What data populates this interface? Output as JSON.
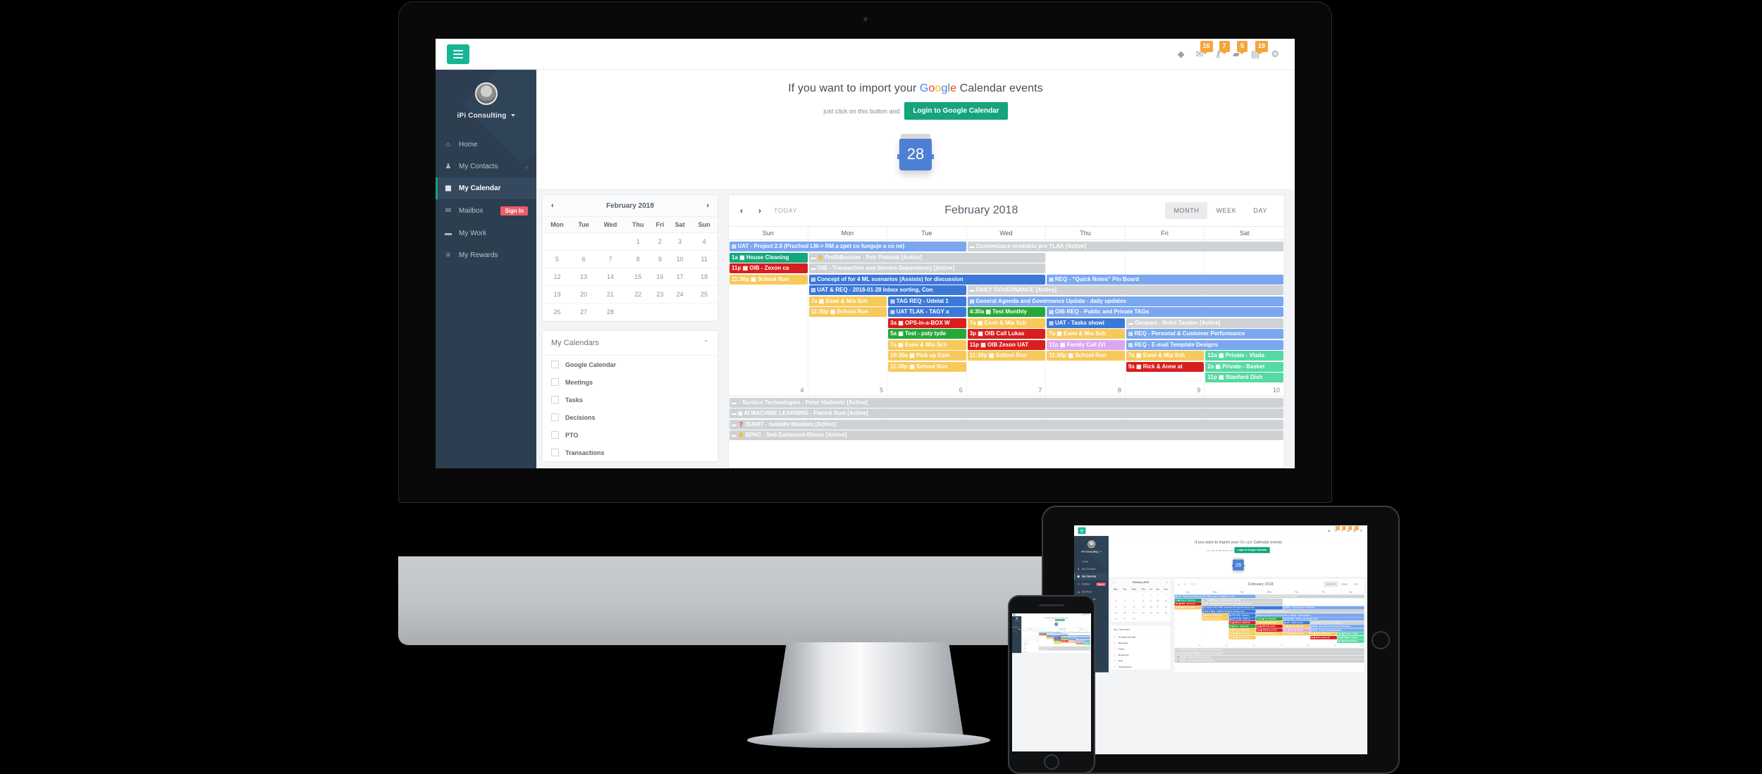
{
  "topbar": {
    "menu_icon": "hamburger-icon",
    "icons": [
      {
        "name": "tag-icon",
        "glyph": "◆",
        "badge": ""
      },
      {
        "name": "mail-icon",
        "glyph": "✉",
        "badge": "16"
      },
      {
        "name": "key-icon",
        "glyph": "⚷",
        "badge": "7"
      },
      {
        "name": "folder-icon",
        "glyph": "▰",
        "badge": "5"
      },
      {
        "name": "card-icon",
        "glyph": "▤",
        "badge": "19"
      },
      {
        "name": "gear-icon",
        "glyph": "⚙",
        "badge": ""
      }
    ]
  },
  "sidebar": {
    "account_name": "iPi Consulting",
    "items": [
      {
        "label": "Home",
        "icon": "⌂",
        "active": false,
        "caret": "",
        "badge": ""
      },
      {
        "label": "My Contacts",
        "icon": "♟",
        "active": false,
        "caret": "‹",
        "badge": ""
      },
      {
        "label": "My Calendar",
        "icon": "▦",
        "active": true,
        "caret": "",
        "badge": ""
      },
      {
        "label": "Mailbox",
        "icon": "✉",
        "active": false,
        "caret": "",
        "badge": "Sign In"
      },
      {
        "label": "My Work",
        "icon": "▬",
        "active": false,
        "caret": "",
        "badge": ""
      },
      {
        "label": "My Rewards",
        "icon": "♕",
        "active": false,
        "caret": "",
        "badge": ""
      }
    ]
  },
  "google_banner": {
    "line1_prefix": "If you want to import your ",
    "brand": {
      "g1": "G",
      "o1": "o",
      "o2": "o",
      "g2": "g",
      "l": "l",
      "e": "e"
    },
    "line1_suffix": " Calendar events",
    "line2": "just click on this button and",
    "button": "Login to Google Calendar",
    "icon_day": "28"
  },
  "mini_calendar": {
    "title": "February 2018",
    "prev": "‹",
    "next": "›",
    "dow": [
      "Mon",
      "Tue",
      "Wed",
      "Thu",
      "Fri",
      "Sat",
      "Sun"
    ],
    "weeks": [
      [
        "",
        "",
        "",
        "1",
        "2",
        "3",
        "4"
      ],
      [
        "5",
        "6",
        "7",
        "8",
        "9",
        "10",
        "11"
      ],
      [
        "12",
        "13",
        "14",
        "15",
        "16",
        "17",
        "18"
      ],
      [
        "19",
        "20",
        "21",
        "22",
        "23",
        "24",
        "25"
      ],
      [
        "26",
        "27",
        "28",
        "",
        "",
        "",
        ""
      ]
    ]
  },
  "my_calendars": {
    "title": "My Calendars",
    "collapse_icon": "⌃",
    "items": [
      "Google Calendar",
      "Meetings",
      "Tasks",
      "Decisions",
      "PTO",
      "Transactions"
    ]
  },
  "big_calendar": {
    "prev": "‹",
    "next": "›",
    "today": "TODAY",
    "title": "February 2018",
    "views": [
      {
        "label": "MONTH",
        "active": true
      },
      {
        "label": "WEEK",
        "active": false
      },
      {
        "label": "DAY",
        "active": false
      }
    ],
    "dow": [
      "Sun",
      "Mon",
      "Tue",
      "Wed",
      "Thu",
      "Fri",
      "Sat"
    ],
    "week1": {
      "daynums": [
        "4",
        "5",
        "6",
        "7",
        "8",
        "9",
        "10"
      ],
      "rows": [
        [
          {
            "col": 1,
            "span": 3,
            "color": "bluelt",
            "icon": "▤",
            "text": "UAT - Project 2.0 (Pruchod LM-> RM a zpet co funguje a co ne)"
          },
          {
            "col": 4,
            "span": 4,
            "color": "gray",
            "icon": "▬",
            "text": "Customizace produktu pro TLAK [Active]"
          }
        ],
        [
          {
            "col": 1,
            "span": 1,
            "color": "green",
            "icon": "",
            "text": "1a ▦ House Cleaning"
          },
          {
            "col": 2,
            "span": 3,
            "color": "gray",
            "icon": "▬ ✋",
            "text": "ProfitBooster - Petr Pistelak [Active]"
          }
        ],
        [
          {
            "col": 1,
            "span": 1,
            "color": "red",
            "icon": "",
            "text": "11p ▦ OIB - Zexon ca"
          },
          {
            "col": 2,
            "span": 3,
            "color": "gray",
            "icon": "▬",
            "text": "OIB - Transaction and Service Dependency [Active]"
          }
        ],
        [
          {
            "col": 1,
            "span": 1,
            "color": "yellow",
            "icon": "",
            "text": "11:30p ▦ School Run"
          },
          {
            "col": 2,
            "span": 3,
            "color": "blue",
            "icon": "▤",
            "text": "Concept of for 4 ML scenarios (Assists) for discussion"
          },
          {
            "col": 5,
            "span": 3,
            "color": "bluelt",
            "icon": "▤",
            "text": "REQ - “Quick Notes” Pin Board"
          }
        ],
        [
          {
            "col": 2,
            "span": 2,
            "color": "blue",
            "icon": "▤",
            "text": "UAT & REQ - 2018-01-28 Inbox sorting, Con"
          },
          {
            "col": 4,
            "span": 4,
            "color": "gray",
            "icon": "▬",
            "text": "DAILY GOVERNANCE [Active]"
          }
        ],
        [
          {
            "col": 2,
            "span": 1,
            "color": "yellow",
            "icon": "",
            "text": "7a ▦ Esmi & Mia Sch"
          },
          {
            "col": 3,
            "span": 1,
            "color": "blue",
            "icon": "▤",
            "text": "TAG REQ - Udelat 1"
          },
          {
            "col": 4,
            "span": 4,
            "color": "bluelt",
            "icon": "▤",
            "text": "General Agenda and Governance Update - daily updates"
          }
        ],
        [
          {
            "col": 2,
            "span": 1,
            "color": "yellow",
            "icon": "",
            "text": "11:30p ▦ School Run"
          },
          {
            "col": 3,
            "span": 1,
            "color": "blue",
            "icon": "▤",
            "text": "UAT TLAK - TAGY a"
          },
          {
            "col": 4,
            "span": 1,
            "color": "greendk",
            "icon": "",
            "text": "4:30a ▦ Test Monthly"
          },
          {
            "col": 5,
            "span": 3,
            "color": "bluelt",
            "icon": "▤",
            "text": "OIB REQ - Public and Private TAGs"
          }
        ],
        [
          {
            "col": 3,
            "span": 1,
            "color": "red",
            "icon": "",
            "text": "3a ▦ OPS-in-a-BOX W"
          },
          {
            "col": 4,
            "span": 1,
            "color": "yellow",
            "icon": "",
            "text": "7a ▦ Esmi & Mia Sch"
          },
          {
            "col": 5,
            "span": 1,
            "color": "blue",
            "icon": "▤",
            "text": "UAT - Tasks showi"
          },
          {
            "col": 6,
            "span": 2,
            "color": "gray",
            "icon": "▬",
            "text": "Genpact - Rohit Tandon [Active]"
          }
        ],
        [
          {
            "col": 3,
            "span": 1,
            "color": "greendk",
            "icon": "",
            "text": "5a ▦ Test - paty tyde"
          },
          {
            "col": 4,
            "span": 1,
            "color": "red",
            "icon": "",
            "text": "3p ▦ OIB Call Lukas"
          },
          {
            "col": 5,
            "span": 1,
            "color": "yellow",
            "icon": "",
            "text": "7a ▦ Esmi & Mia Sch"
          },
          {
            "col": 6,
            "span": 2,
            "color": "bluelt",
            "icon": "▤",
            "text": "REQ - Personal & Customer Performance"
          }
        ],
        [
          {
            "col": 3,
            "span": 1,
            "color": "yellow",
            "icon": "",
            "text": "7a ▦ Esmi & Mia Sch"
          },
          {
            "col": 4,
            "span": 1,
            "color": "red",
            "icon": "",
            "text": "11p ▦ OIB Zexon UAT"
          },
          {
            "col": 5,
            "span": 1,
            "color": "purple",
            "icon": "",
            "text": "11p ▦ Family Call (Vl"
          },
          {
            "col": 6,
            "span": 2,
            "color": "bluelt",
            "icon": "▤",
            "text": "REQ - E-mail Template Designs"
          }
        ],
        [
          {
            "col": 3,
            "span": 1,
            "color": "yellow",
            "icon": "",
            "text": "10:30a ▦ Pick up Esm"
          },
          {
            "col": 4,
            "span": 1,
            "color": "yellow",
            "icon": "",
            "text": "11:30p ▦ School Run"
          },
          {
            "col": 5,
            "span": 1,
            "color": "yellow",
            "icon": "",
            "text": "11:30p ▦ School Run"
          },
          {
            "col": 6,
            "span": 1,
            "color": "yellow",
            "icon": "",
            "text": "7a ▦ Esmi & Mia Sch"
          },
          {
            "col": 7,
            "span": 1,
            "color": "mint",
            "icon": "",
            "text": "12a ▦ Private - Vlada"
          }
        ],
        [
          {
            "col": 3,
            "span": 1,
            "color": "yellow",
            "icon": "",
            "text": "11:30p ▦ School Run"
          },
          {
            "col": 6,
            "span": 1,
            "color": "red",
            "icon": "",
            "text": "9a ▦ Rick & Anne at"
          },
          {
            "col": 7,
            "span": 1,
            "color": "mint",
            "icon": "",
            "text": "2a ▦ Private - Basket"
          }
        ],
        [
          {
            "col": 7,
            "span": 1,
            "color": "mint",
            "icon": "",
            "text": "11p ▦ Stanford Dish"
          }
        ]
      ]
    },
    "week2": {
      "rows": [
        [
          {
            "col": 1,
            "span": 7,
            "color": "gray",
            "icon": "▬ ◔",
            "text": "Sonitus Technologies - Peter Hadrovic [Active]"
          }
        ],
        [
          {
            "col": 1,
            "span": 7,
            "color": "gray",
            "icon": "▬ ▣",
            "text": "AI MACHINE LEARNING - Patrick Suel [Active]"
          }
        ],
        [
          {
            "col": 1,
            "span": 7,
            "color": "gray",
            "icon": "▬ ❓",
            "text": "ISAHIT - Isabelle Mashola [Active]"
          }
        ],
        [
          {
            "col": 1,
            "span": 7,
            "color": "gray",
            "icon": "▬ ✋",
            "text": "BPHC - Seb Eastwood-Bloom [Active]"
          }
        ]
      ]
    }
  },
  "colors": {
    "brand_green": "#15b596",
    "sidebar": "#2c3e50",
    "sidebar_active": "#34495e",
    "badge_orange": "#f5a53c",
    "signin_red": "#eb5d68",
    "google_blue": "#4285F4",
    "google_red": "#EA4335",
    "google_yellow": "#FBBC05",
    "google_green": "#34A853"
  }
}
